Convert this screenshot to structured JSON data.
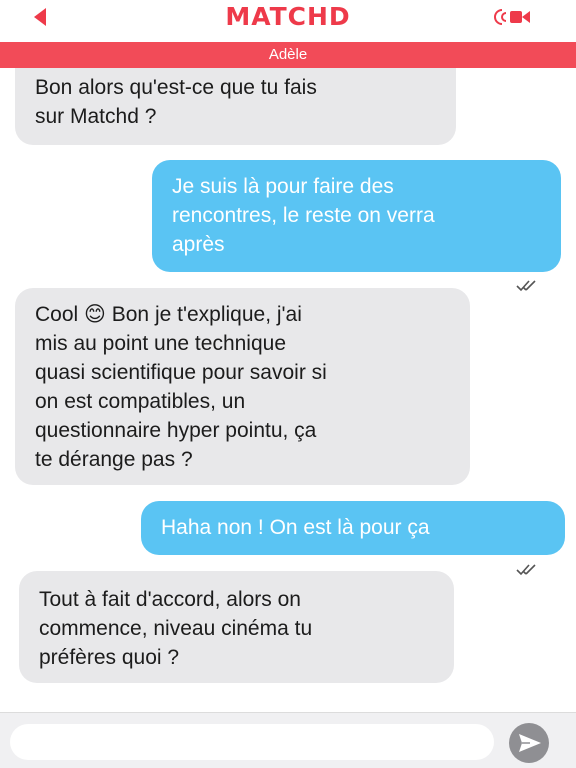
{
  "header": {
    "logo_text": "MATCHD",
    "back_icon": "back-arrow-icon",
    "call_icon": "video-call-icon",
    "contact_name": "Adèle"
  },
  "messages": [
    {
      "side": "received",
      "text": "Bon alors qu'est-ce que tu fais\nsur Matchd ?"
    },
    {
      "side": "sent",
      "text": "Je suis là pour faire des\nrencontres, le reste on verra\naprès",
      "read": true
    },
    {
      "side": "received",
      "text": "Cool 😊 Bon je t'explique, j'ai\nmis au point une technique\nquasi scientifique pour savoir si\non est compatibles, un\nquestionnaire hyper pointu, ça\nte dérange pas ?"
    },
    {
      "side": "sent",
      "text": "Haha non ! On est là pour ça",
      "read": true
    },
    {
      "side": "received",
      "text": "Tout à fait d'accord, alors on\ncommence, niveau cinéma tu\npréfères quoi ?"
    }
  ],
  "composer": {
    "placeholder": "",
    "send_icon": "send-icon"
  },
  "colors": {
    "brand": "#ee3a4a",
    "name_bar": "#f24b58",
    "sent_bubble": "#5ac4f3",
    "received_bubble": "#e8e8ea"
  }
}
